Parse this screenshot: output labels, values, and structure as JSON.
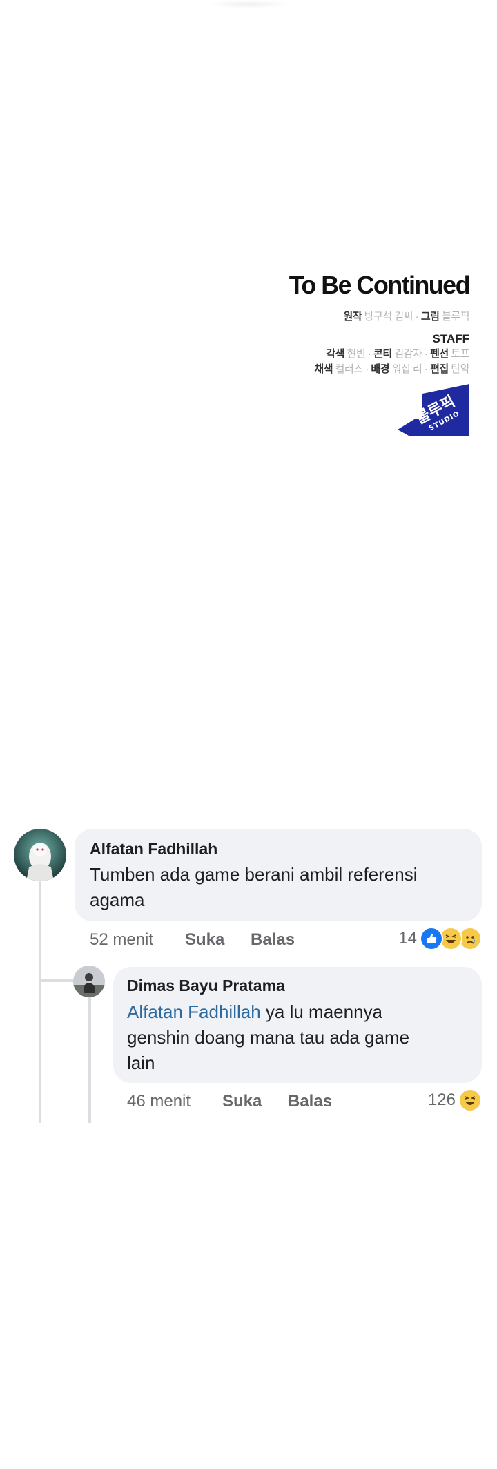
{
  "credits": {
    "title": "To Be Continued",
    "line1": {
      "label1": "원작",
      "value1": "방구석 김씨 ·",
      "label2": "그림",
      "value2": "블루픽"
    },
    "staff_label": "STAFF",
    "line2": {
      "label1": "각색",
      "value1": "현빈 ·",
      "label2": "콘티",
      "value2": "김감자 ·",
      "label3": "펜선",
      "value3": "토프"
    },
    "line3": {
      "label1": "채색",
      "value1": "컬러즈 ·",
      "label2": "배경",
      "value2": "워십 리 ·",
      "label3": "편집",
      "value3": "탄약"
    },
    "logo": {
      "text": "블루픽",
      "sub": "STUDIO",
      "color": "#1f2aa0"
    }
  },
  "comments": [
    {
      "author": "Alfatan Fadhillah",
      "text": "Tumben ada game berani ambil referensi agama",
      "time": "52 menit",
      "like_label": "Suka",
      "reply_label": "Balas",
      "reaction_count": "14",
      "reactions": [
        "like-icon",
        "haha-icon",
        "sad-icon"
      ]
    },
    {
      "author": "Dimas Bayu Pratama",
      "mention": "Alfatan Fadhillah",
      "text": " ya lu maennya genshin doang mana tau ada game lain",
      "time": "46 menit",
      "like_label": "Suka",
      "reply_label": "Balas",
      "reaction_count": "126",
      "reactions": [
        "haha-icon"
      ]
    }
  ],
  "colors": {
    "bubble": "#f0f2f5",
    "mention": "#2d6a9f",
    "meta": "#65676b",
    "like_blue": "#1877f2",
    "emoji_yellow": "#f7c948"
  }
}
